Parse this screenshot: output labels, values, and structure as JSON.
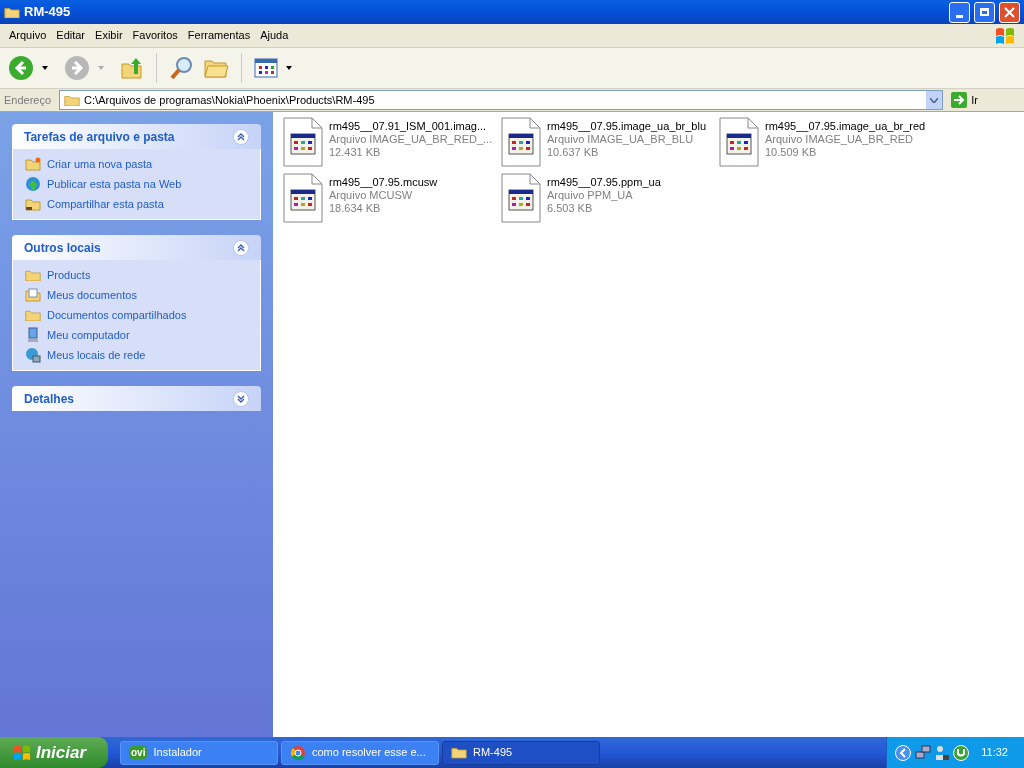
{
  "window": {
    "title": "RM-495"
  },
  "menu": [
    "Arquivo",
    "Editar",
    "Exibir",
    "Favoritos",
    "Ferramentas",
    "Ajuda"
  ],
  "address": {
    "label": "Endereço",
    "value": "C:\\Arquivos de programas\\Nokia\\Phoenix\\Products\\RM-495",
    "go": "Ir"
  },
  "sidebar": [
    {
      "title": "Tarefas de arquivo e pasta",
      "expanded": true,
      "items": [
        {
          "label": "Criar uma nova pasta",
          "kind": "newfolder"
        },
        {
          "label": "Publicar esta pasta na Web",
          "kind": "web"
        },
        {
          "label": "Compartilhar esta pasta",
          "kind": "share"
        }
      ]
    },
    {
      "title": "Outros locais",
      "expanded": true,
      "items": [
        {
          "label": "Products",
          "kind": "folder"
        },
        {
          "label": "Meus documentos",
          "kind": "documents"
        },
        {
          "label": "Documentos compartilhados",
          "kind": "folder"
        },
        {
          "label": "Meu computador",
          "kind": "computer"
        },
        {
          "label": "Meus locais de rede",
          "kind": "network"
        }
      ]
    },
    {
      "title": "Detalhes",
      "expanded": false
    }
  ],
  "files": [
    {
      "name": "rm495__07.91_ISM_001.imag...",
      "type": "Arquivo IMAGE_UA_BR_RED_...",
      "size": "12.431 KB"
    },
    {
      "name": "rm495__07.95.image_ua_br_blu",
      "type": "Arquivo IMAGE_UA_BR_BLU",
      "size": "10.637 KB"
    },
    {
      "name": "rm495__07.95.image_ua_br_red",
      "type": "Arquivo IMAGE_UA_BR_RED",
      "size": "10.509 KB"
    },
    {
      "name": "rm495__07.95.mcusw",
      "type": "Arquivo MCUSW",
      "size": "18.634 KB"
    },
    {
      "name": "rm495__07.95.ppm_ua",
      "type": "Arquivo PPM_UA",
      "size": "6.503 KB"
    }
  ],
  "taskbar": {
    "start": "Iniciar",
    "tasks": [
      {
        "label": "Instalador",
        "kind": "ovi",
        "badge": "ovi",
        "selected": false
      },
      {
        "label": "como resolver esse e...",
        "kind": "browser",
        "selected": false
      },
      {
        "label": "RM-495",
        "kind": "folder",
        "selected": true
      }
    ],
    "clock": "11:32"
  }
}
